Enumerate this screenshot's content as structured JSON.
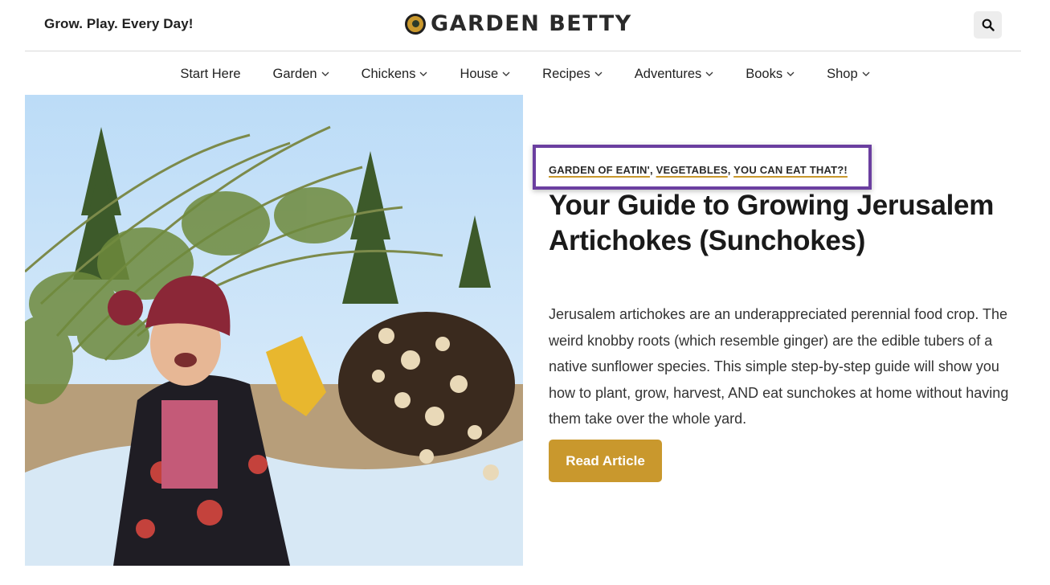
{
  "header": {
    "tagline": "Grow. Play. Every Day!",
    "logo_text": "GARDEN BETTY",
    "search_icon": "search-icon"
  },
  "nav": {
    "items": [
      {
        "label": "Start Here",
        "has_dropdown": false
      },
      {
        "label": "Garden",
        "has_dropdown": true
      },
      {
        "label": "Chickens",
        "has_dropdown": true
      },
      {
        "label": "House",
        "has_dropdown": true
      },
      {
        "label": "Recipes",
        "has_dropdown": true
      },
      {
        "label": "Adventures",
        "has_dropdown": true
      },
      {
        "label": "Books",
        "has_dropdown": true
      },
      {
        "label": "Shop",
        "has_dropdown": true
      }
    ]
  },
  "article": {
    "categories": [
      "GARDEN OF EATIN'",
      "VEGETABLES",
      "YOU CAN EAT THAT?!"
    ],
    "separator": ",",
    "title": "Your Guide to Growing Jerusalem Artichokes (Sunchokes)",
    "excerpt": "Jerusalem artichokes are an underappreciated perennial food crop. The weird knobby roots (which resemble ginger) are the edible tubers of a native sunflower species. This simple step-by-step guide will show you how to plant, grow, harvest, AND eat sunchokes at home without having them take over the whole yard.",
    "read_button": "Read Article"
  },
  "colors": {
    "accent": "#c9982d",
    "highlight_border": "#6b3fa0",
    "text": "#1a1a1a"
  }
}
